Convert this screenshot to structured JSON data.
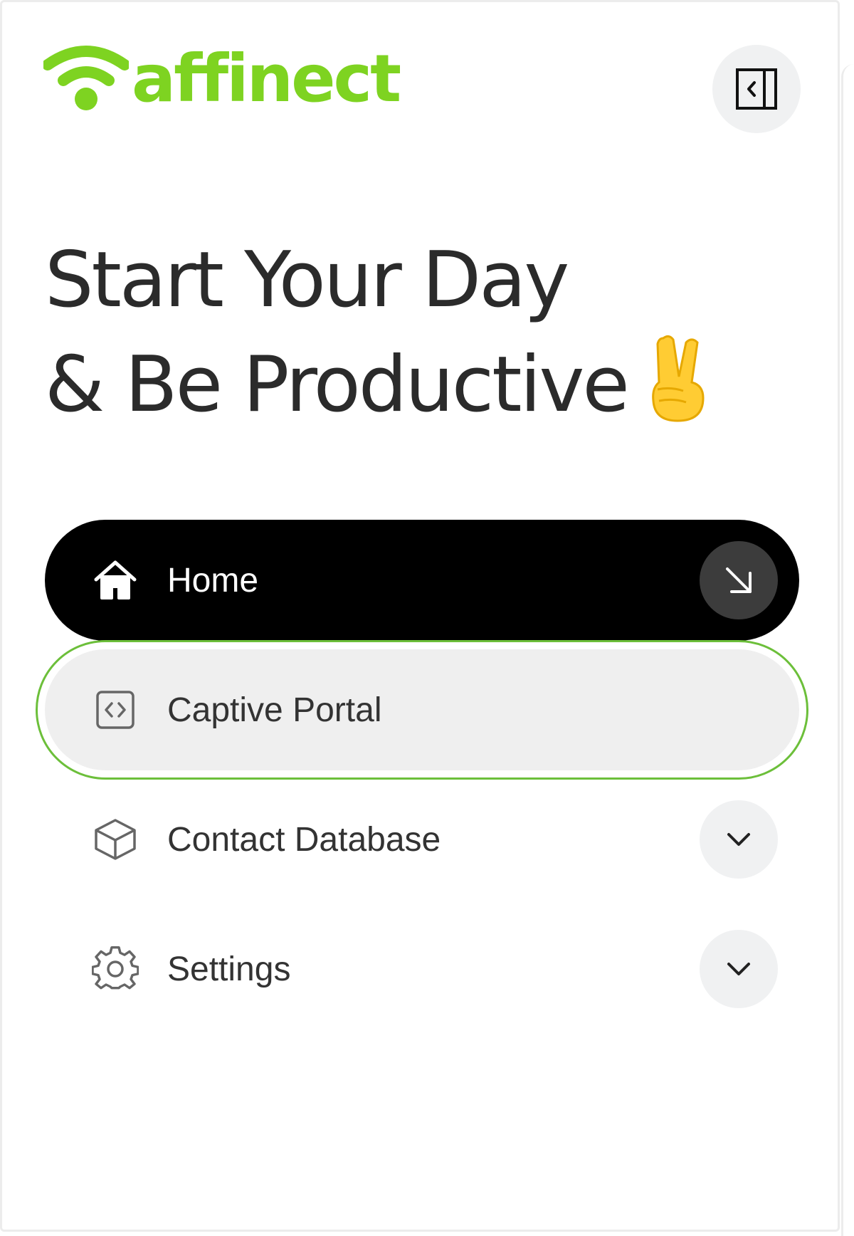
{
  "colors": {
    "brand": "#7ed321",
    "focus": "#6cbf3a",
    "active_bg": "#000000",
    "hover_bg": "#efefef"
  },
  "logo": {
    "text": "affinect",
    "icon": "wifi-logo-icon"
  },
  "header": {
    "collapse_icon": "sidebar-collapse-icon"
  },
  "headline": {
    "line1": "Start Your Day",
    "line2": "& Be Productive",
    "emoji_icon": "victory-hand-icon"
  },
  "nav": {
    "items": [
      {
        "label": "Home",
        "icon": "home-icon",
        "action_icon": "arrow-down-right-icon",
        "active": true
      },
      {
        "label": "Captive Portal",
        "icon": "code-icon",
        "highlighted": true
      },
      {
        "label": "Contact Database",
        "icon": "cube-icon",
        "action_icon": "chevron-down-icon"
      },
      {
        "label": "Settings",
        "icon": "gear-icon",
        "action_icon": "chevron-down-icon"
      }
    ]
  }
}
